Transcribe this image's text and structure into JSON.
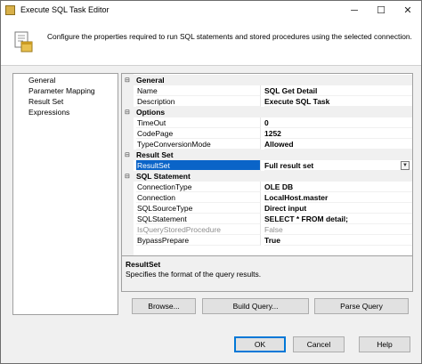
{
  "window": {
    "title": "Execute SQL Task Editor",
    "minimize_glyph": "─",
    "maximize_glyph": "☐",
    "close_glyph": "✕"
  },
  "header": {
    "description": "Configure the properties required to run SQL statements and stored procedures using the selected connection.",
    "icon": "sql-task-icon"
  },
  "nav": {
    "items": [
      {
        "label": "General"
      },
      {
        "label": "Parameter Mapping"
      },
      {
        "label": "Result Set"
      },
      {
        "label": "Expressions"
      }
    ]
  },
  "properties": {
    "categories": [
      {
        "label": "General",
        "expander": "⊟",
        "rows": [
          {
            "name": "Name",
            "value": "SQL Get Detail"
          },
          {
            "name": "Description",
            "value": "Execute SQL Task"
          }
        ]
      },
      {
        "label": "Options",
        "expander": "⊟",
        "rows": [
          {
            "name": "TimeOut",
            "value": "0"
          },
          {
            "name": "CodePage",
            "value": "1252"
          },
          {
            "name": "TypeConversionMode",
            "value": "Allowed"
          }
        ]
      },
      {
        "label": "Result Set",
        "expander": "⊟",
        "rows": [
          {
            "name": "ResultSet",
            "value": "Full result set",
            "selected": true
          }
        ]
      },
      {
        "label": "SQL Statement",
        "expander": "⊟",
        "rows": [
          {
            "name": "ConnectionType",
            "value": "OLE DB"
          },
          {
            "name": "Connection",
            "value": "LocalHost.master"
          },
          {
            "name": "SQLSourceType",
            "value": "Direct input"
          },
          {
            "name": "SQLStatement",
            "value": "SELECT * FROM detail;"
          },
          {
            "name": "IsQueryStoredProcedure",
            "value": "False",
            "disabled": true
          },
          {
            "name": "BypassPrepare",
            "value": "True"
          }
        ]
      }
    ],
    "dropdown_glyph": "▼"
  },
  "description_panel": {
    "title": "ResultSet",
    "text": "Specifies the format of the query results."
  },
  "buttons": {
    "browse": "Browse...",
    "build_query": "Build Query...",
    "parse_query": "Parse Query",
    "ok": "OK",
    "cancel": "Cancel",
    "help": "Help"
  },
  "colors": {
    "selection": "#0a64c8",
    "window_bg": "#f0f0f0",
    "default_button_border": "#0078d7"
  }
}
